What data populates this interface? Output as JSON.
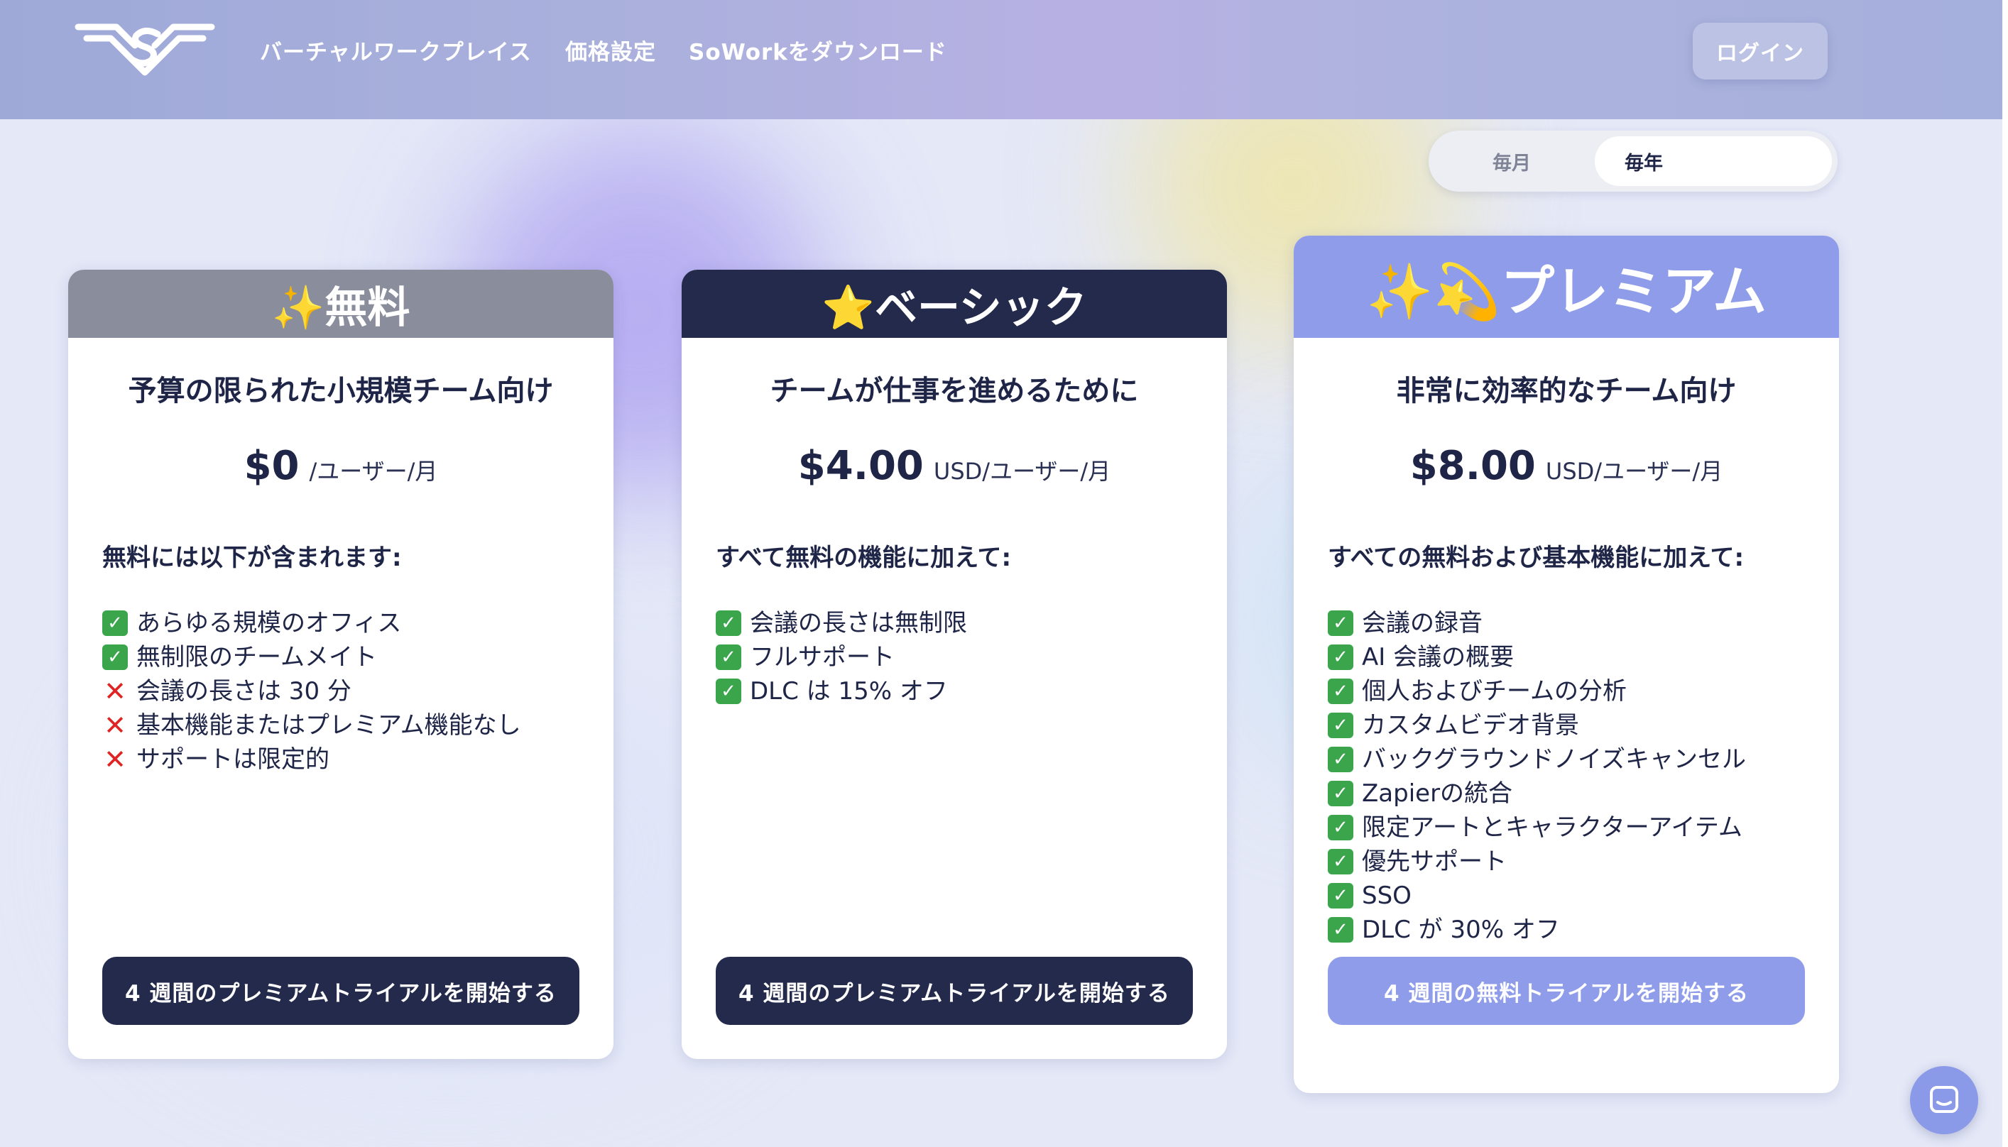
{
  "nav": {
    "links": [
      "バーチャルワークプレイス",
      "価格設定",
      "SoWorkをダウンロード"
    ],
    "login_label": "ログイン"
  },
  "billing_toggle": {
    "monthly_label": "毎月",
    "yearly_label": "毎年",
    "selected": "yearly"
  },
  "plans": [
    {
      "name": "✨無料",
      "subtitle": "予算の限られた小規模チーム向け",
      "price": "$0",
      "price_unit": "/ユーザー/月",
      "includes_title": "無料には以下が含まれます:",
      "features": [
        {
          "text": "あらゆる規模のオフィス",
          "included": true
        },
        {
          "text": "無制限のチームメイト",
          "included": true
        },
        {
          "text": "会議の長さは 30 分",
          "included": false
        },
        {
          "text": "基本機能またはプレミアム機能なし",
          "included": false
        },
        {
          "text": "サポートは限定的",
          "included": false
        }
      ],
      "cta_label": "4 週間のプレミアムトライアルを開始する",
      "header_color": "#8a8d9b",
      "cta_color": "#232a4c"
    },
    {
      "name": "⭐ベーシック",
      "subtitle": "チームが仕事を進めるために",
      "price": "$4.00",
      "price_unit": "USD/ユーザー/月",
      "includes_title": "すべて無料の機能に加えて:",
      "features": [
        {
          "text": "会議の長さは無制限",
          "included": true
        },
        {
          "text": "フルサポート",
          "included": true
        },
        {
          "text": "DLC は 15% オフ",
          "included": true
        }
      ],
      "cta_label": "4 週間のプレミアムトライアルを開始する",
      "header_color": "#232a4c",
      "cta_color": "#232a4c"
    },
    {
      "name": "✨💫プレミアム",
      "subtitle": "非常に効率的なチーム向け",
      "price": "$8.00",
      "price_unit": "USD/ユーザー/月",
      "includes_title": "すべての無料および基本機能に加えて:",
      "features": [
        {
          "text": "会議の録音",
          "included": true
        },
        {
          "text": "AI 会議の概要",
          "included": true
        },
        {
          "text": "個人およびチームの分析",
          "included": true
        },
        {
          "text": "カスタムビデオ背景",
          "included": true
        },
        {
          "text": "バックグラウンドノイズキャンセル",
          "included": true
        },
        {
          "text": "Zapierの統合",
          "included": true
        },
        {
          "text": "限定アートとキャラクターアイテム",
          "included": true
        },
        {
          "text": "優先サポート",
          "included": true
        },
        {
          "text": "SSO",
          "included": true
        },
        {
          "text": "DLC が 30% オフ",
          "included": true
        }
      ],
      "cta_label": "4 週間の無料トライアルを開始する",
      "header_color": "#8f9cea",
      "cta_color": "#8f9cea"
    }
  ],
  "icons": {
    "logo": "sowork-wings-logo-icon",
    "included": "check-mark-icon",
    "excluded": "cross-mark-icon",
    "chat": "chat-bubble-icon"
  }
}
